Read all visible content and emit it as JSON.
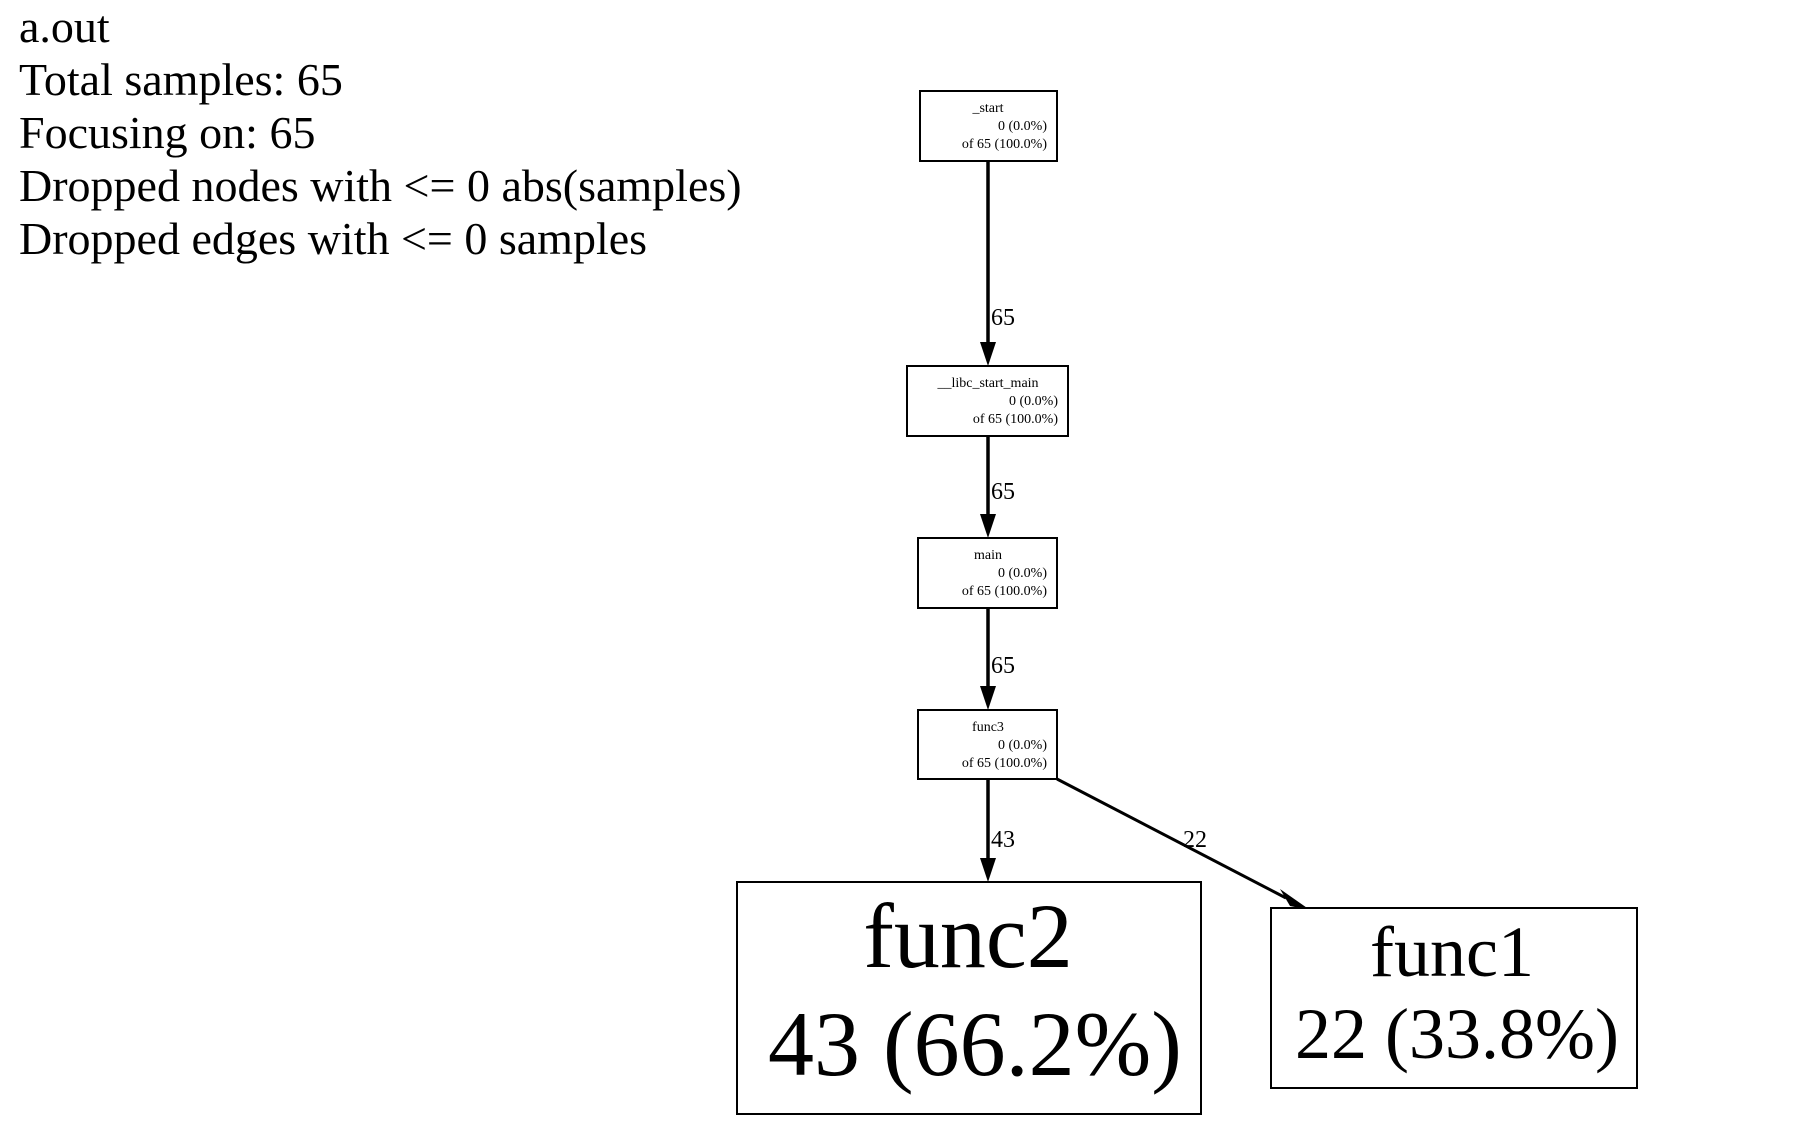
{
  "legend": {
    "program": "a.out",
    "total_samples": "Total samples: 65",
    "focusing_on": "Focusing on: 65",
    "dropped_nodes": "Dropped nodes with <= 0 abs(samples)",
    "dropped_edges": "Dropped edges with <= 0 samples"
  },
  "graph": {
    "nodes": [
      {
        "id": "start",
        "name": "_start",
        "flat": "0 (0.0%)",
        "cum": "of 65 (100.0%)"
      },
      {
        "id": "libc_start_main",
        "name": "__libc_start_main",
        "flat": "0 (0.0%)",
        "cum": "of 65 (100.0%)"
      },
      {
        "id": "main",
        "name": "main",
        "flat": "0 (0.0%)",
        "cum": "of 65 (100.0%)"
      },
      {
        "id": "func3",
        "name": "func3",
        "flat": "0 (0.0%)",
        "cum": "of 65 (100.0%)"
      },
      {
        "id": "func2",
        "name": "func2",
        "flat": "43 (66.2%)",
        "cum": ""
      },
      {
        "id": "func1",
        "name": "func1",
        "flat": "22 (33.8%)",
        "cum": ""
      }
    ],
    "edges": [
      {
        "from": "start",
        "to": "libc_start_main",
        "label": "65"
      },
      {
        "from": "libc_start_main",
        "to": "main",
        "label": "65"
      },
      {
        "from": "main",
        "to": "func3",
        "label": "65"
      },
      {
        "from": "func3",
        "to": "func2",
        "label": "43"
      },
      {
        "from": "func3",
        "to": "func1",
        "label": "22"
      }
    ]
  }
}
